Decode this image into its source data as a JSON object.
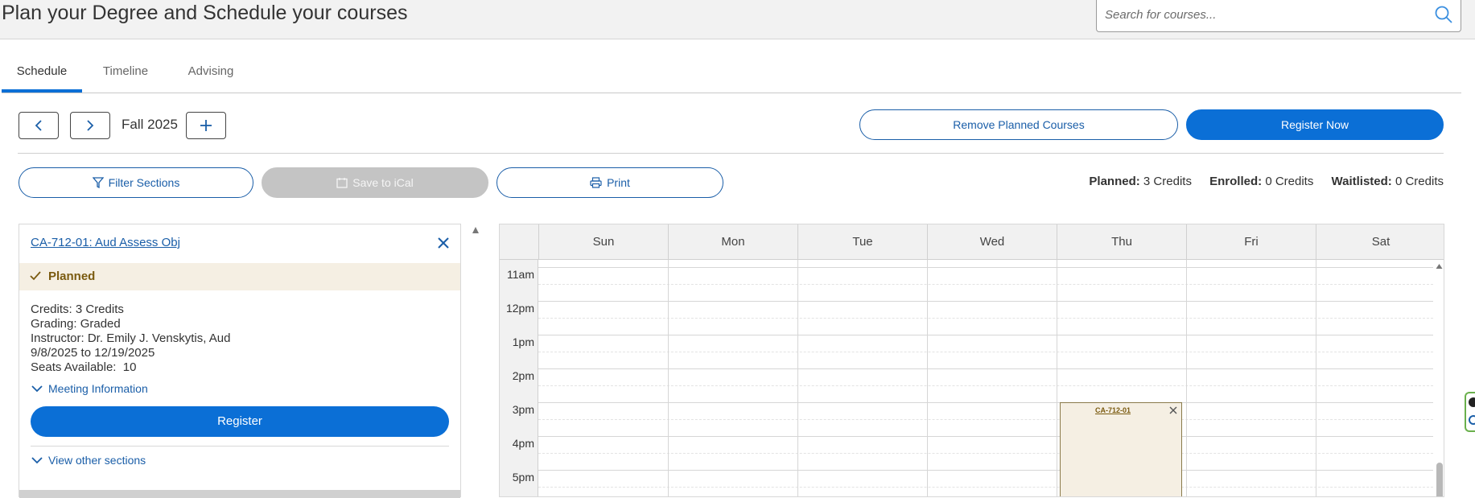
{
  "header": {
    "title": "Plan your Degree and Schedule your courses",
    "search_placeholder": "Search for courses..."
  },
  "tabs": [
    {
      "label": "Schedule",
      "active": true
    },
    {
      "label": "Timeline",
      "active": false
    },
    {
      "label": "Advising",
      "active": false
    }
  ],
  "toolbar": {
    "term": "Fall 2025",
    "remove_planned_label": "Remove Planned Courses",
    "register_now_label": "Register Now",
    "filter_sections_label": "Filter Sections",
    "save_ical_label": "Save to iCal",
    "print_label": "Print"
  },
  "credits": {
    "planned_label": "Planned:",
    "planned_value": "3 Credits",
    "enrolled_label": "Enrolled:",
    "enrolled_value": "0 Credits",
    "waitlisted_label": "Waitlisted:",
    "waitlisted_value": "0 Credits"
  },
  "course_card": {
    "title": "CA-712-01: Aud Assess Obj",
    "status": "Planned",
    "credits_line": "Credits: 3 Credits",
    "grading_line": "Grading: Graded",
    "instructor_line": "Instructor: Dr. Emily J. Venskytis, Aud",
    "dates_line": "9/8/2025 to 12/19/2025",
    "seats_line": "Seats Available:  10",
    "meeting_info_label": "Meeting Information",
    "register_label": "Register",
    "view_other_label": "View other sections"
  },
  "calendar": {
    "days": [
      "Sun",
      "Mon",
      "Tue",
      "Wed",
      "Thu",
      "Fri",
      "Sat"
    ],
    "times": [
      "11am",
      "12pm",
      "1pm",
      "2pm",
      "3pm",
      "4pm",
      "5pm"
    ],
    "event": {
      "label": "CA-712-01",
      "day": "Thu",
      "start": "3pm"
    }
  },
  "colors": {
    "accent": "#0b6fd6",
    "link": "#1a5ea8",
    "planned_bg": "#f5efe3",
    "planned_text": "#7a5a0f"
  }
}
